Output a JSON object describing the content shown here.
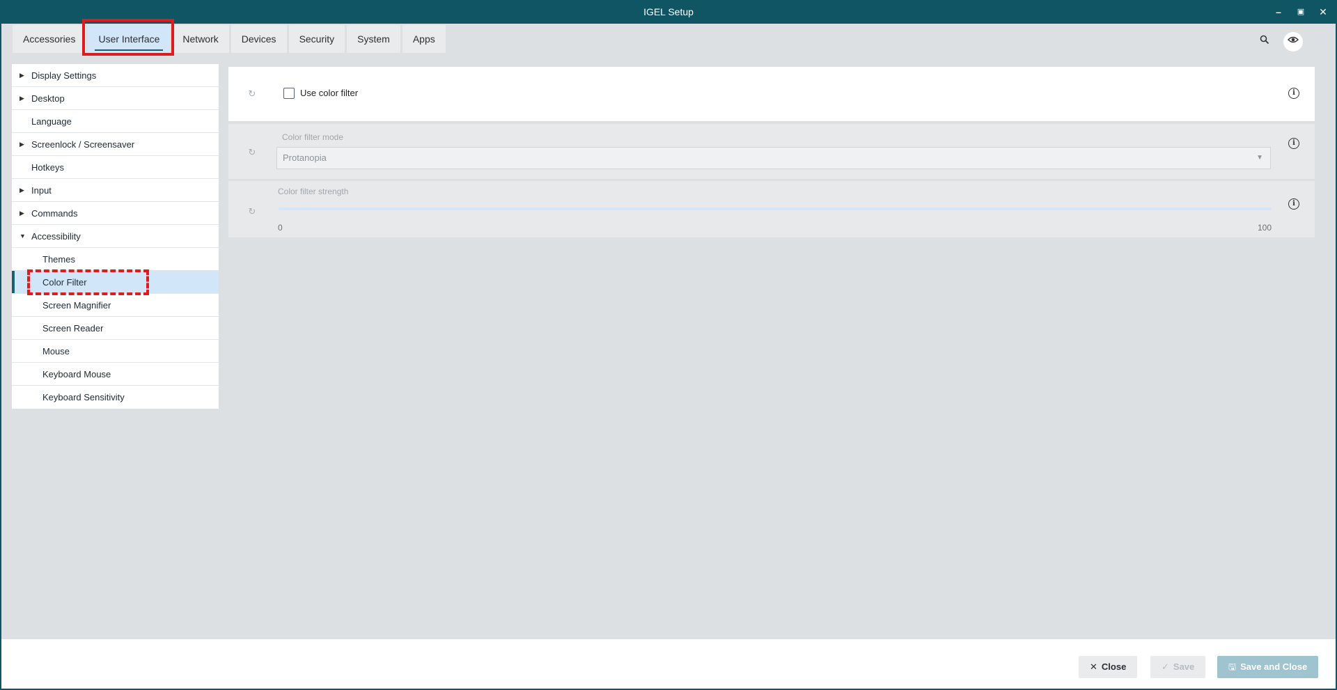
{
  "window": {
    "title": "IGEL Setup",
    "controls": [
      "minimize-icon",
      "restore-icon",
      "close-icon"
    ]
  },
  "tabs": [
    {
      "label": "Accessories",
      "active": false
    },
    {
      "label": "User Interface",
      "active": true
    },
    {
      "label": "Network",
      "active": false
    },
    {
      "label": "Devices",
      "active": false
    },
    {
      "label": "Security",
      "active": false
    },
    {
      "label": "System",
      "active": false
    },
    {
      "label": "Apps",
      "active": false
    }
  ],
  "toolbar_icons": [
    "search-icon",
    "eye-settings-icon"
  ],
  "sidebar": {
    "items": [
      {
        "label": "Display Settings",
        "expandable": true,
        "expanded": false
      },
      {
        "label": "Desktop",
        "expandable": true,
        "expanded": false
      },
      {
        "label": "Language",
        "expandable": false
      },
      {
        "label": "Screenlock / Screensaver",
        "expandable": true,
        "expanded": false
      },
      {
        "label": "Hotkeys",
        "expandable": false
      },
      {
        "label": "Input",
        "expandable": true,
        "expanded": false
      },
      {
        "label": "Commands",
        "expandable": true,
        "expanded": false
      },
      {
        "label": "Accessibility",
        "expandable": true,
        "expanded": true
      },
      {
        "label": "Themes",
        "sub": true
      },
      {
        "label": "Color Filter",
        "sub": true,
        "selected": true
      },
      {
        "label": "Screen Magnifier",
        "sub": true
      },
      {
        "label": "Screen Reader",
        "sub": true
      },
      {
        "label": "Mouse",
        "sub": true
      },
      {
        "label": "Keyboard Mouse",
        "sub": true
      },
      {
        "label": "Keyboard Sensitivity",
        "sub": true
      }
    ]
  },
  "content": {
    "use_color_filter": {
      "label": "Use color filter",
      "checked": false
    },
    "color_filter_mode": {
      "label": "Color filter mode",
      "value": "Protanopia",
      "enabled": false
    },
    "color_filter_strength": {
      "label": "Color filter strength",
      "min": "0",
      "max": "100",
      "enabled": false
    }
  },
  "footer": {
    "close_label": "Close",
    "save_label": "Save",
    "save_close_label": "Save and Close"
  },
  "colors": {
    "titlebar": "#0f5563",
    "accent": "#1b5f73",
    "selected_bg": "#d2e6fa",
    "highlight_red": "#e01b1b"
  }
}
